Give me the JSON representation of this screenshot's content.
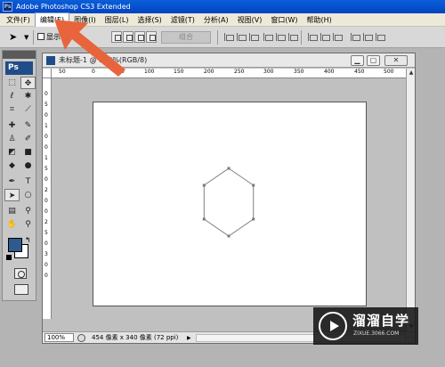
{
  "window": {
    "title": "Adobe Photoshop CS3 Extended",
    "app_icon": "Ps"
  },
  "menu": {
    "items": [
      "文件(F)",
      "编辑(E)",
      "图像(I)",
      "图层(L)",
      "选择(S)",
      "滤镜(T)",
      "分析(A)",
      "视图(V)",
      "窗口(W)",
      "帮助(H)"
    ],
    "active_index": 1
  },
  "options": {
    "show_checkbox_label": "显示",
    "combine_label": "组合"
  },
  "tools": {
    "logo": "Ps",
    "foreground_color": "#2e5b8c",
    "background_color": "#ffffff"
  },
  "document": {
    "title": "未标题-1 @ 100%(RGB/8)",
    "ruler_h_labels": [
      "50",
      "0",
      "50",
      "100",
      "150",
      "200",
      "250",
      "300",
      "350",
      "400",
      "450",
      "500"
    ],
    "ruler_v_labels": [
      "0",
      "5",
      "0",
      "1",
      "0",
      "0",
      "1",
      "5",
      "0",
      "2",
      "0",
      "0",
      "2",
      "5",
      "0",
      "3",
      "0",
      "0"
    ],
    "zoom": "100%",
    "info": "454 像素 x 340 像素 (72 ppi)"
  },
  "shape": {
    "type": "hexagon",
    "stroke_color": "#808080"
  },
  "annotation": {
    "arrow_color": "#e8643c",
    "arrow_target": "编辑(E)"
  },
  "watermark": {
    "name": "溜溜自学",
    "url": "ZIXUE.3066.COM"
  }
}
